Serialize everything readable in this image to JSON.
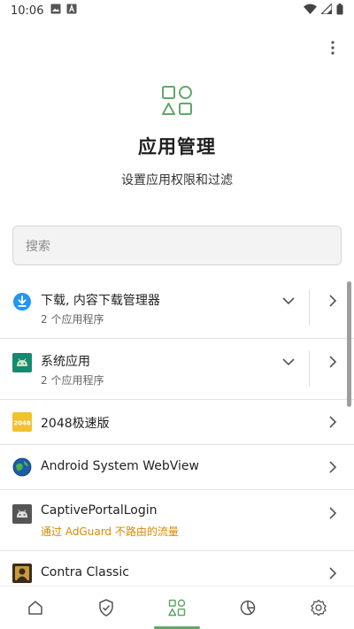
{
  "status_bar": {
    "time": "10:06",
    "icons": [
      "image-icon",
      "a-icon",
      "wifi-icon",
      "signal-icon",
      "battery-icon"
    ]
  },
  "header": {
    "menu_icon": "more-vert-icon",
    "hero_icon": "apps-shapes-icon",
    "title": "应用管理",
    "subtitle": "设置应用权限和过滤"
  },
  "search": {
    "placeholder": "搜索",
    "value": ""
  },
  "apps": [
    {
      "name": "下载, 内容下载管理器",
      "subtitle": "2 个应用程序",
      "icon": "download-manager-icon",
      "expandable": true
    },
    {
      "name": "系统应用",
      "subtitle": "2 个应用程序",
      "icon": "android-icon",
      "expandable": true
    },
    {
      "name": "2048极速版",
      "icon": "game-2048-icon",
      "icon_text": "2048",
      "expandable": false
    },
    {
      "name": "Android System WebView",
      "icon": "webview-globe-icon",
      "expandable": false
    },
    {
      "name": "CaptivePortalLogin",
      "subtitle": "通过 AdGuard 不路由的流量",
      "subtitle_type": "warning",
      "icon": "android-icon",
      "expandable": false
    },
    {
      "name": "Contra Classic",
      "icon": "contra-game-icon",
      "expandable": false
    }
  ],
  "bottom_nav": {
    "items": [
      {
        "id": "home",
        "icon": "home-icon"
      },
      {
        "id": "protection",
        "icon": "shield-check-icon"
      },
      {
        "id": "apps",
        "icon": "apps-shapes-icon",
        "active": true
      },
      {
        "id": "statistics",
        "icon": "pie-chart-icon"
      },
      {
        "id": "settings",
        "icon": "gear-icon"
      }
    ]
  },
  "colors": {
    "accent": "#5fa868",
    "warning": "#d98a00",
    "download_icon_bg": "#2196f3",
    "android_icon_bg": "#17896f",
    "game_2048_bg": "#f2c12e"
  }
}
